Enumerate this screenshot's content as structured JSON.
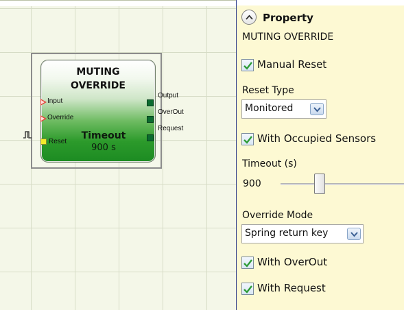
{
  "function_block": {
    "title_line1": "MUTING",
    "title_line2": "OVERRIDE",
    "inputs": [
      {
        "label": "Input"
      },
      {
        "label": "Override"
      },
      {
        "label": "Reset"
      }
    ],
    "outputs": [
      {
        "label": "Output"
      },
      {
        "label": "OverOut"
      },
      {
        "label": "Request"
      }
    ],
    "timeout_label": "Timeout",
    "timeout_value": "900 s"
  },
  "reset_symbol": "Πɫ",
  "panel": {
    "heading": "Property",
    "subtitle": "MUTING OVERRIDE",
    "manual_reset": {
      "label": "Manual Reset",
      "checked": true
    },
    "reset_type": {
      "label": "Reset Type",
      "value": "Monitored"
    },
    "with_occupied_sensors": {
      "label": "With Occupied Sensors",
      "checked": true
    },
    "timeout": {
      "label": "Timeout (s)",
      "value": "900"
    },
    "override_mode": {
      "label": "Override Mode",
      "value": "Spring return key"
    },
    "with_overout": {
      "label": "With OverOut",
      "checked": true
    },
    "with_request": {
      "label": "With Request",
      "checked": true
    }
  },
  "colors": {
    "panel_bg": "#fdf9d3",
    "canvas_bg": "#f4f7e8",
    "block_green": "#2c9a2b",
    "check_green": "#2e9c37",
    "input_arrow": "#e2443a",
    "reset_port": "#f4ea2b",
    "output_port": "#0b6b2f"
  },
  "icons": {
    "collapse": "chevron-up-icon",
    "checkbox": "check-icon",
    "dropdown": "chevron-down-icon",
    "reset_symbol": "pulse-icon"
  }
}
